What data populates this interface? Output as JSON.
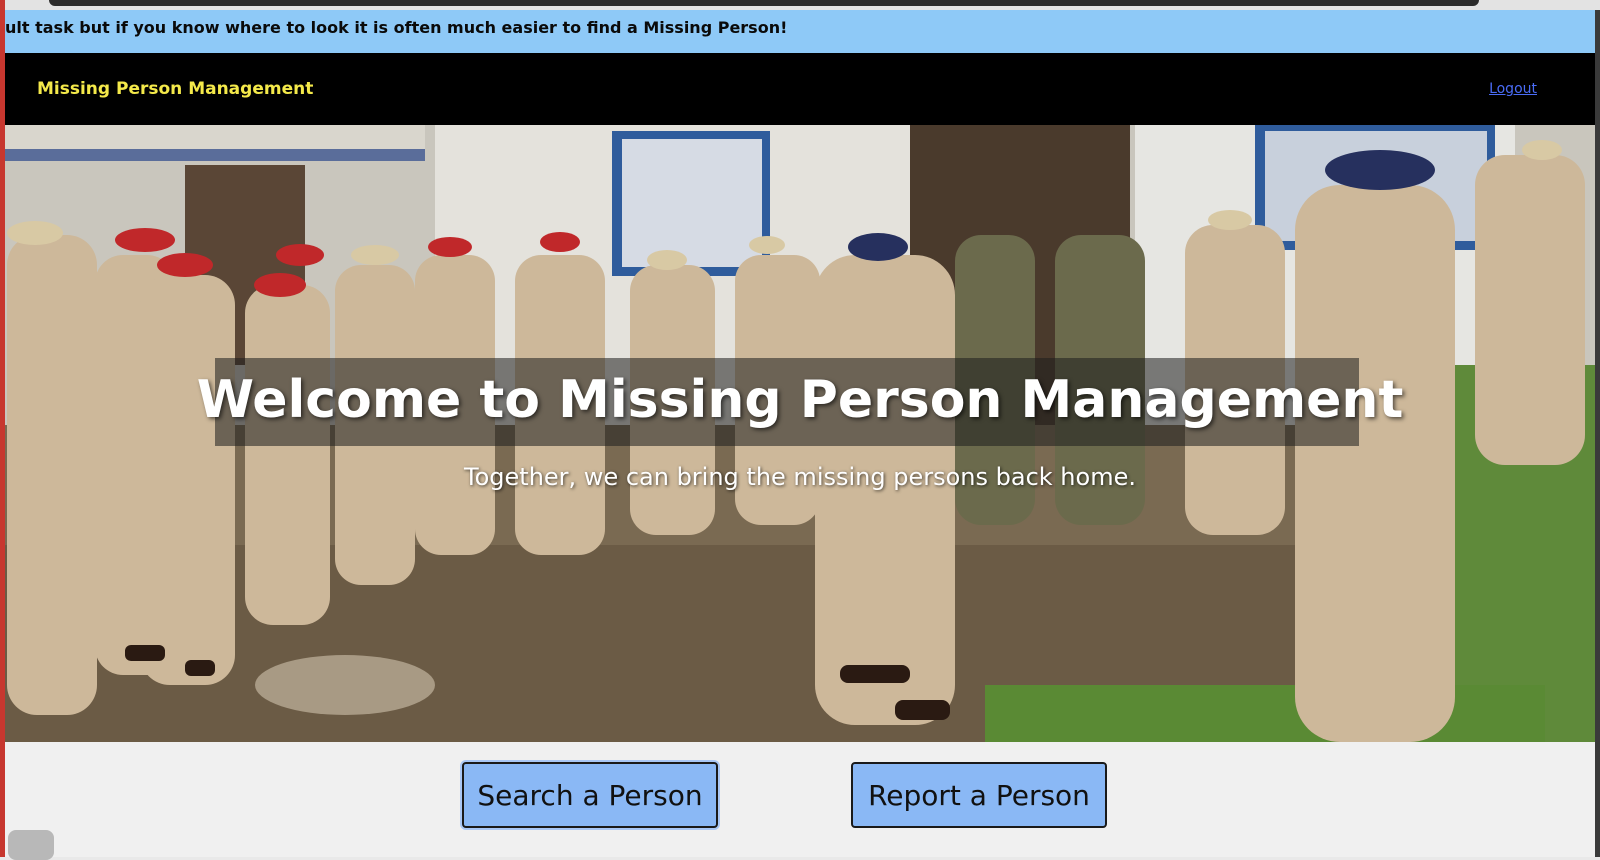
{
  "marquee": {
    "text": "ult task but if you know where to look it is often much easier to find a Missing Person!"
  },
  "navbar": {
    "brand": "Missing Person Management",
    "logout_label": "Logout"
  },
  "hero": {
    "title": "Welcome to Missing Person Management",
    "subtitle": "Together, we can bring the missing persons back home."
  },
  "actions": {
    "search_label": "Search a Person",
    "report_label": "Report a Person"
  },
  "colors": {
    "marquee_bg": "#8ec9f7",
    "navbar_bg": "#000000",
    "brand_color": "#f4e94a",
    "logout_color": "#4a6cf7",
    "button_bg": "#8ab8f5"
  }
}
